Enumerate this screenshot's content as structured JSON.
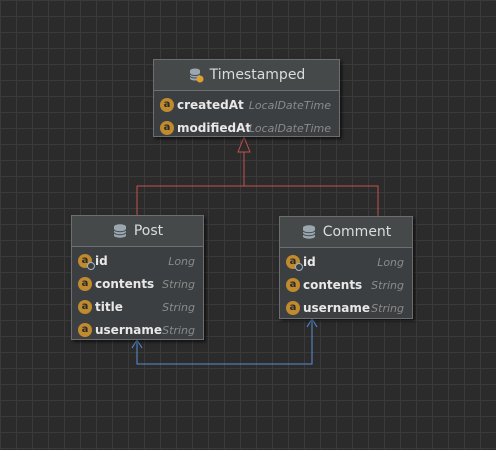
{
  "colors": {
    "background": "#2b2b2b",
    "entity_fill": "#3c3f41",
    "entity_border": "#6e6e6e",
    "field_badge": "#c08a2e",
    "inheritance_edge": "#c0504d",
    "association_edge": "#5b8fd6",
    "type_text": "#8a8a8a"
  },
  "entities": {
    "timestamped": {
      "title": "Timestamped",
      "icon": "abstract-class-icon",
      "fields": [
        {
          "badge": "a",
          "name": "createdAt",
          "type": "LocalDateTime"
        },
        {
          "badge": "a",
          "name": "modifiedAt",
          "type": "LocalDateTime"
        }
      ]
    },
    "post": {
      "title": "Post",
      "icon": "entity-icon",
      "fields": [
        {
          "badge": "a",
          "name": "id",
          "type": "Long",
          "key": true
        },
        {
          "badge": "a",
          "name": "contents",
          "type": "String"
        },
        {
          "badge": "a",
          "name": "title",
          "type": "String"
        },
        {
          "badge": "a",
          "name": "username",
          "type": "String"
        }
      ]
    },
    "comment": {
      "title": "Comment",
      "icon": "entity-icon",
      "fields": [
        {
          "badge": "a",
          "name": "id",
          "type": "Long",
          "key": true
        },
        {
          "badge": "a",
          "name": "contents",
          "type": "String"
        },
        {
          "badge": "a",
          "name": "username",
          "type": "String"
        }
      ]
    }
  },
  "relations": [
    {
      "kind": "inheritance",
      "from": "post",
      "to": "timestamped"
    },
    {
      "kind": "inheritance",
      "from": "comment",
      "to": "timestamped"
    },
    {
      "kind": "association",
      "from": "post",
      "to": "comment",
      "bidirectional": true
    }
  ]
}
